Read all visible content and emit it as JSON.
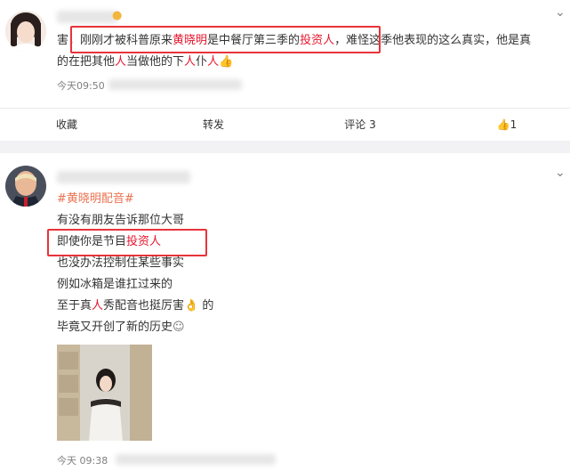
{
  "post1": {
    "line1_start": "害，",
    "line1_a": "刚刚才被科普原来",
    "line1_name": "黄晓明",
    "line1_b": "是中餐厅第三季的",
    "line1_investor": "投资人",
    "line1_c": "，难怪这季他表现的这么真实，他是真",
    "line2_a": "的在把其他",
    "line2_ren1": "人",
    "line2_b": "当做他的下",
    "line2_ren2": "人",
    "line2_c": "仆",
    "line2_ren3": "人",
    "time": "今天09:50",
    "actions": {
      "favorite": "收藏",
      "repost": "转发",
      "comment": "评论 3",
      "like_count": "1"
    }
  },
  "post2": {
    "hashtag": "#黄晓明配音#",
    "lines": [
      "有没有朋友告诉那位大哥",
      "即使你是节目",
      "也没办法控制住某些事实",
      "例如冰箱是谁扛过来的",
      "至于真",
      "毕竟又开创了新的历史"
    ],
    "investor": "投资人",
    "line5_ren": "人",
    "line5_rest": "秀配音也挺厉害",
    "line5_end": "的",
    "time": "今天 09:38"
  },
  "colors": {
    "accent": "#eb7350",
    "highlight_box": "#e8343a",
    "separator": "#f2f2f5"
  }
}
